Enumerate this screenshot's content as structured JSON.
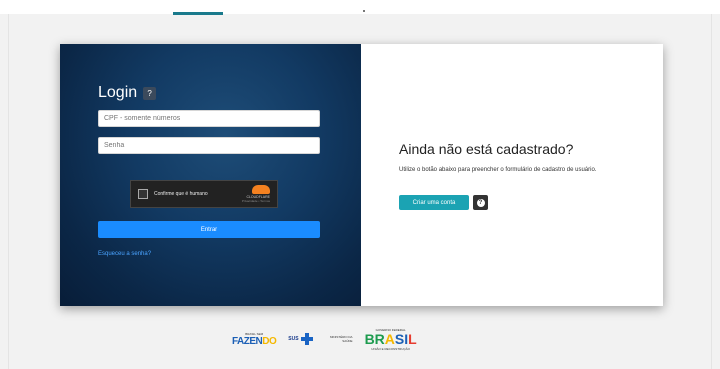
{
  "login": {
    "title": "Login",
    "cpf_placeholder": "CPF - somente números",
    "password_placeholder": "Senha",
    "enter_label": "Entrar",
    "forgot_label": "Esqueceu a senha?"
  },
  "captcha": {
    "label": "Confirme que é humano",
    "brand": "CLOUDFLARE",
    "links": "Privacidade • Termos"
  },
  "register": {
    "title": "Ainda não está cadastrado?",
    "description": "Utilize o botão abaixo para preencher o formulário de cadastro de usuário.",
    "create_label": "Criar uma conta",
    "help_icon": "question-icon"
  },
  "footer": {
    "fazendo_top": "BRASIL SEM",
    "fazendo_word_a": "FAZEN",
    "fazendo_word_b": "DO",
    "sus": "SUS",
    "ministerio": "MINISTÉRIO DA SAÚDE",
    "gov_top": "GOVERNO FEDERAL",
    "brasil_1": "BR",
    "brasil_2": "A",
    "brasil_3": "SI",
    "brasil_4": "L",
    "gov_bottom": "UNIÃO E RECONSTRUÇÃO"
  },
  "colors": {
    "primary_button": "#1a8cff",
    "create_button": "#1ba3b3",
    "panel_dark": "#0b2747"
  }
}
